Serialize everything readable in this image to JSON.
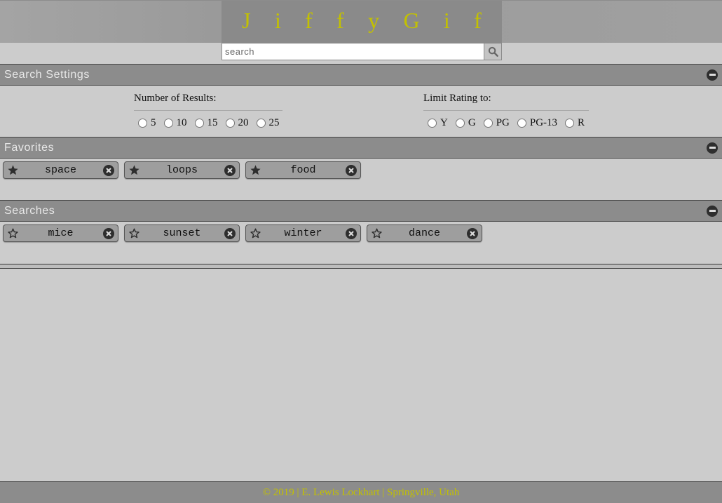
{
  "header": {
    "logo_letters": [
      "J",
      "i",
      "f",
      "f",
      "y",
      "G",
      "i",
      "f"
    ],
    "search_placeholder": "search"
  },
  "sections": {
    "settings": {
      "title": "Search Settings"
    },
    "favorites": {
      "title": "Favorites"
    },
    "searches": {
      "title": "Searches"
    }
  },
  "settings": {
    "results": {
      "label": "Number of Results:",
      "options": [
        "5",
        "10",
        "15",
        "20",
        "25"
      ]
    },
    "rating": {
      "label": "Limit Rating to:",
      "options": [
        "Y",
        "G",
        "PG",
        "PG-13",
        "R"
      ]
    }
  },
  "favorites": [
    "space",
    "loops",
    "food"
  ],
  "searches": [
    "mice",
    "sunset",
    "winter",
    "dance"
  ],
  "footer": {
    "text": "© 2019 | E. Lewis Lockhart | Springville, Utah"
  },
  "colors": {
    "accent": "#c3c100",
    "bar": "#8c8c8c",
    "background": "#cccccc"
  }
}
